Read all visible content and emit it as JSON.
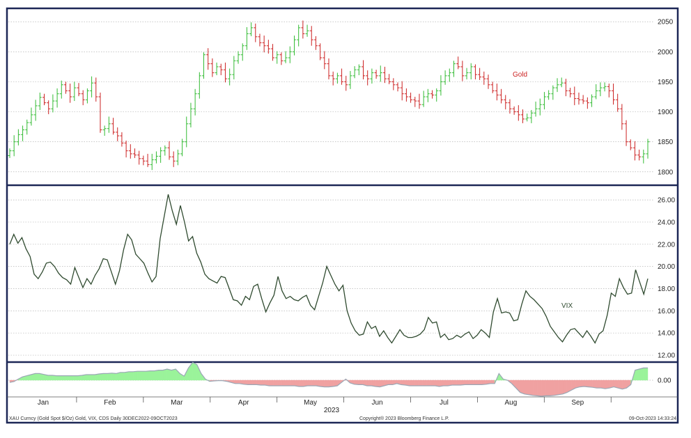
{
  "chart_data": [
    {
      "type": "candlestick",
      "title": "Gold",
      "series": [
        {
          "name": "Gold",
          "color": "#cc2222"
        }
      ],
      "ylim": [
        1780,
        2070
      ],
      "yticks": [
        "2050",
        "2000",
        "1950",
        "1900",
        "1850",
        "1800"
      ],
      "colors": {
        "up": "#33bb33",
        "down": "#cc2222"
      },
      "grid": true,
      "axis_side": "right",
      "close": [
        1835,
        1850,
        1862,
        1870,
        1882,
        1895,
        1910,
        1924,
        1915,
        1905,
        1918,
        1930,
        1945,
        1935,
        1925,
        1940,
        1930,
        1920,
        1935,
        1948,
        1925,
        1870,
        1872,
        1880,
        1866,
        1860,
        1848,
        1835,
        1830,
        1828,
        1822,
        1818,
        1812,
        1820,
        1826,
        1835,
        1840,
        1825,
        1818,
        1830,
        1850,
        1880,
        1905,
        1930,
        1960,
        1995,
        1980,
        1965,
        1975,
        1970,
        1955,
        1962,
        1985,
        1995,
        2010,
        2030,
        2040,
        2025,
        2015,
        2010,
        2005,
        1990,
        1995,
        1985,
        1990,
        2000,
        2020,
        2040,
        2030,
        2035,
        2020,
        2010,
        1990,
        1980,
        1960,
        1955,
        1960,
        1950,
        1945,
        1960,
        1970,
        1975,
        1960,
        1955,
        1965,
        1960,
        1965,
        1955,
        1950,
        1945,
        1940,
        1930,
        1925,
        1920,
        1918,
        1912,
        1925,
        1930,
        1928,
        1935,
        1950,
        1960,
        1965,
        1980,
        1975,
        1960,
        1965,
        1975,
        1962,
        1958,
        1955,
        1945,
        1935,
        1928,
        1920,
        1915,
        1905,
        1900,
        1895,
        1888,
        1890,
        1898,
        1905,
        1912,
        1925,
        1930,
        1940,
        1945,
        1948,
        1935,
        1930,
        1922,
        1920,
        1918,
        1915,
        1925,
        1935,
        1940,
        1942,
        1935,
        1920,
        1905,
        1880,
        1850,
        1840,
        1828,
        1825,
        1830,
        1850
      ],
      "source": "XAU Curncy (Gold Spot   $/Oz) Gold, VIX, CDS  Daily 30DEC2022-09OCT2023"
    },
    {
      "type": "line",
      "title": "VIX",
      "series": [
        {
          "name": "VIX",
          "color": "#2f4a2f"
        }
      ],
      "ylim": [
        11.5,
        27.2
      ],
      "yticks": [
        "26.00",
        "24.00",
        "22.00",
        "20.00",
        "18.00",
        "16.00",
        "14.00",
        "12.00"
      ],
      "grid": true,
      "axis_side": "right",
      "values": [
        22.0,
        22.9,
        22.1,
        22.6,
        21.6,
        20.9,
        19.3,
        18.9,
        19.5,
        20.3,
        20.4,
        20.0,
        19.4,
        19.0,
        18.8,
        18.4,
        19.9,
        19.0,
        18.1,
        18.9,
        18.4,
        19.2,
        19.8,
        20.7,
        20.6,
        19.5,
        18.4,
        19.6,
        21.5,
        22.9,
        22.4,
        21.1,
        20.7,
        20.3,
        19.4,
        18.6,
        19.1,
        22.5,
        24.5,
        26.5,
        25.0,
        23.8,
        25.5,
        24.0,
        22.3,
        22.7,
        21.2,
        20.4,
        19.3,
        18.9,
        18.7,
        18.5,
        19.1,
        19.0,
        18.0,
        17.0,
        16.9,
        16.5,
        17.3,
        17.0,
        18.2,
        18.4,
        17.1,
        15.9,
        16.7,
        17.4,
        19.1,
        17.8,
        17.1,
        17.3,
        17.0,
        16.9,
        17.2,
        17.4,
        16.5,
        16.1,
        17.3,
        18.5,
        20.0,
        19.2,
        18.4,
        17.8,
        18.3,
        16.0,
        14.9,
        14.2,
        13.8,
        13.9,
        15.0,
        14.4,
        14.6,
        13.7,
        14.2,
        13.6,
        13.1,
        13.7,
        14.3,
        13.8,
        13.6,
        13.6,
        13.7,
        13.9,
        14.3,
        15.4,
        14.9,
        15.0,
        13.6,
        13.9,
        13.4,
        13.5,
        13.8,
        13.6,
        13.9,
        14.1,
        13.5,
        13.8,
        14.3,
        14.0,
        13.6,
        15.9,
        17.1,
        15.8,
        15.9,
        15.8,
        15.1,
        15.2,
        16.6,
        17.8,
        17.3,
        17.0,
        16.6,
        16.2,
        15.5,
        14.6,
        14.1,
        13.6,
        13.2,
        13.8,
        14.3,
        14.4,
        14.0,
        13.6,
        14.2,
        13.7,
        13.1,
        13.9,
        14.2,
        15.6,
        17.6,
        17.3,
        18.9,
        18.1,
        17.5,
        17.6,
        19.7,
        18.6,
        17.5,
        18.9
      ]
    },
    {
      "type": "area",
      "series": [
        {
          "name": "CDS"
        }
      ],
      "ylim": [
        -0.75,
        0.75
      ],
      "yticks": [
        "0.00"
      ],
      "colors": {
        "positive": "#9af39a",
        "negative": "#f0a1a1"
      },
      "grid": true,
      "axis_side": "right",
      "values": [
        -0.1,
        -0.06,
        0.05,
        0.15,
        0.2,
        0.25,
        0.3,
        0.3,
        0.26,
        0.22,
        0.22,
        0.2,
        0.2,
        0.2,
        0.2,
        0.2,
        0.2,
        0.22,
        0.25,
        0.25,
        0.25,
        0.28,
        0.3,
        0.3,
        0.32,
        0.3,
        0.35,
        0.35,
        0.38,
        0.38,
        0.4,
        0.4,
        0.4,
        0.42,
        0.42,
        0.45,
        0.45,
        0.5,
        0.45,
        0.5,
        0.3,
        0.18,
        0.55,
        0.8,
        0.7,
        0.3,
        0.05,
        -0.05,
        -0.03,
        -0.02,
        -0.02,
        -0.05,
        -0.1,
        -0.15,
        -0.15,
        -0.18,
        -0.2,
        -0.2,
        -0.2,
        -0.22,
        -0.22,
        -0.25,
        -0.25,
        -0.25,
        -0.25,
        -0.25,
        -0.25,
        -0.25,
        -0.28,
        -0.28,
        -0.25,
        -0.25,
        -0.25,
        -0.28,
        -0.3,
        -0.3,
        -0.28,
        -0.25,
        -0.1,
        0.05,
        -0.12,
        -0.18,
        -0.2,
        -0.2,
        -0.25,
        -0.25,
        -0.28,
        -0.3,
        -0.25,
        -0.2,
        -0.2,
        -0.15,
        -0.2,
        -0.22,
        -0.25,
        -0.25,
        -0.25,
        -0.25,
        -0.25,
        -0.25,
        -0.25,
        -0.28,
        -0.25,
        -0.25,
        -0.22,
        -0.22,
        -0.22,
        -0.2,
        -0.2,
        -0.2,
        -0.2,
        -0.2,
        -0.18,
        -0.15,
        -0.15,
        0.3,
        0.05,
        0.0,
        -0.15,
        -0.35,
        -0.55,
        -0.62,
        -0.65,
        -0.68,
        -0.7,
        -0.72,
        -0.7,
        -0.7,
        -0.68,
        -0.65,
        -0.62,
        -0.55,
        -0.45,
        -0.35,
        -0.3,
        -0.28,
        -0.3,
        -0.32,
        -0.35,
        -0.35,
        -0.38,
        -0.35,
        -0.3,
        -0.35,
        -0.4,
        -0.35,
        -0.2,
        0.45,
        0.5,
        0.55,
        0.55
      ]
    }
  ],
  "x_axis": {
    "months": [
      "Jan",
      "Feb",
      "Mar",
      "Apr",
      "May",
      "Jun",
      "Jul",
      "Aug",
      "Sep"
    ],
    "year": "2023"
  },
  "footer": {
    "source": "XAU Curncy (Gold Spot   $/Oz) Gold, VIX, CDS  Daily 30DEC2022-09OCT2023",
    "copyright": "Copyright® 2023 Bloomberg Finance L.P.",
    "timestamp": "09-Oct-2023 14:33:24"
  },
  "colors": {
    "frame": "#1c2756",
    "up": "#33bb33",
    "down": "#cc2222",
    "vix": "#2f4a2f"
  }
}
